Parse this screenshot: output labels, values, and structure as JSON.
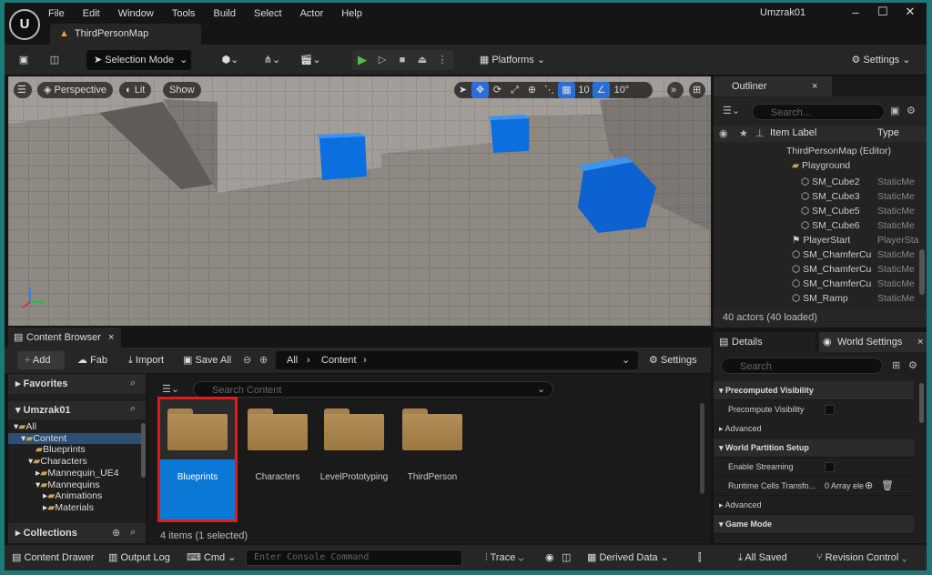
{
  "app": {
    "logo": "U",
    "username": "Umzrak01",
    "map_tab": "ThirdPersonMap"
  },
  "menu": [
    "File",
    "Edit",
    "Window",
    "Tools",
    "Build",
    "Select",
    "Actor",
    "Help"
  ],
  "toolbar": {
    "mode": "Selection Mode",
    "platforms": "Platforms",
    "settings": "Settings"
  },
  "viewport": {
    "perspective": "Perspective",
    "lit": "Lit",
    "show": "Show",
    "grid_snap": "10",
    "rot_snap": "10°"
  },
  "outliner": {
    "title": "Outliner",
    "search_placeholder": "Search...",
    "col_label": "Item Label",
    "col_type": "Type",
    "rows": [
      {
        "label": "ThirdPersonMap (Editor)",
        "type": ""
      },
      {
        "label": "Playground",
        "type": ""
      },
      {
        "label": "SM_Cube2",
        "type": "StaticMe"
      },
      {
        "label": "SM_Cube3",
        "type": "StaticMe"
      },
      {
        "label": "SM_Cube5",
        "type": "StaticMe"
      },
      {
        "label": "SM_Cube6",
        "type": "StaticMe"
      },
      {
        "label": "PlayerStart",
        "type": "PlayerSta"
      },
      {
        "label": "SM_ChamferCu",
        "type": "StaticMe"
      },
      {
        "label": "SM_ChamferCu",
        "type": "StaticMe"
      },
      {
        "label": "SM_ChamferCu",
        "type": "StaticMe"
      },
      {
        "label": "SM_Ramp",
        "type": "StaticMe"
      }
    ],
    "status": "40 actors (40 loaded)"
  },
  "content_browser": {
    "tab": "Content Browser",
    "add": "Add",
    "fab": "Fab",
    "import": "Import",
    "save_all": "Save All",
    "path_all": "All",
    "path_content": "Content",
    "settings": "Settings",
    "search_placeholder": "Search Content",
    "favorites": "Favorites",
    "project": "Umzrak01",
    "collections": "Collections",
    "tree": [
      "All",
      "Content",
      "Blueprints",
      "Characters",
      "Mannequin_UE4",
      "Mannequins",
      "Animations",
      "Materials"
    ],
    "folders": [
      "Blueprints",
      "Characters",
      "LevelPrototyping",
      "ThirdPerson"
    ],
    "status": "4 items (1 selected)"
  },
  "details": {
    "tab_details": "Details",
    "tab_world": "World Settings",
    "search_placeholder": "Search",
    "rows": [
      {
        "label": "Precomputed Visibility",
        "kind": "section",
        "value": ""
      },
      {
        "label": "Precompute Visibility",
        "kind": "prop",
        "value": ""
      },
      {
        "label": "Advanced",
        "kind": "sub",
        "value": ""
      },
      {
        "label": "World Partition Setup",
        "kind": "section",
        "value": ""
      },
      {
        "label": "Enable Streaming",
        "kind": "prop",
        "value": ""
      },
      {
        "label": "Runtime Cells Transfo...",
        "kind": "prop",
        "value": "0 Array ele"
      },
      {
        "label": "Advanced",
        "kind": "sub",
        "value": ""
      },
      {
        "label": "Game Mode",
        "kind": "section",
        "value": ""
      }
    ]
  },
  "statusbar": {
    "content_drawer": "Content Drawer",
    "output_log": "Output Log",
    "cmd": "Cmd",
    "console_placeholder": "Enter Console Command",
    "trace": "Trace",
    "derived_data": "Derived Data",
    "all_saved": "All Saved",
    "revision_control": "Revision Control"
  },
  "colors": {
    "accent": "#2a6fd6",
    "selected": "#0b78d6",
    "highlight_box": "#e01b1b",
    "folder": "#a9854f",
    "play": "#4dc14a"
  }
}
